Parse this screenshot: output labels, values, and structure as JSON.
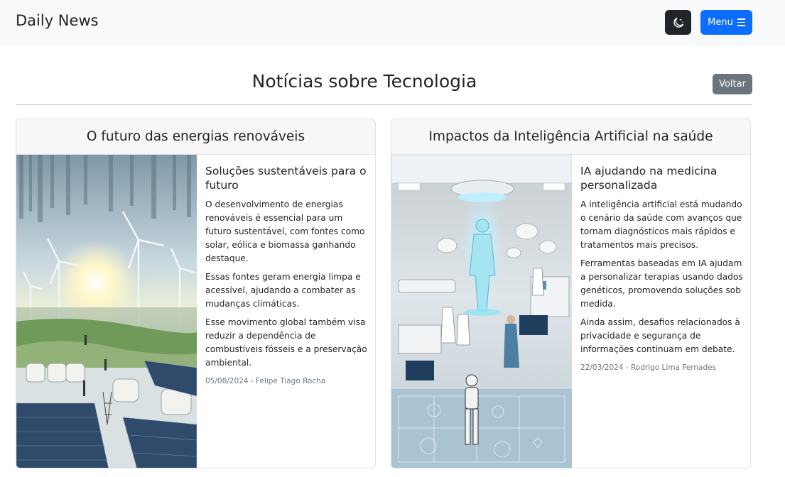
{
  "navbar": {
    "brand": "Daily News",
    "menu_label": "Menu",
    "theme_icon": "moon-stars-icon",
    "menu_icon": "hamburger-icon"
  },
  "page": {
    "title": "Notícias sobre Tecnologia",
    "back_label": "Voltar"
  },
  "colors": {
    "primary": "#0d6efd",
    "dark": "#212529",
    "secondary": "#6c757d",
    "navbar_bg": "#f8f9fa"
  },
  "articles": [
    {
      "header": "O futuro das energias renováveis",
      "title": "Soluções sustentáveis para o futuro",
      "paragraphs": [
        "O desenvolvimento de energias renováveis é essencial para um futuro sustentável, com fontes como solar, eólica e biomassa ganhando destaque.",
        "Essas fontes geram energia limpa e acessível, ajudando a combater as mudanças climáticas.",
        "Esse movimento global também visa reduzir a dependência de combustíveis fósseis e a preservação ambiental."
      ],
      "meta": "05/08/2024 - Felipe Tiago Rocha"
    },
    {
      "header": "Impactos da Inteligência Artificial na saúde",
      "title": "IA ajudando na medicina personalizada",
      "paragraphs": [
        "A inteligência artificial está mudando o cenário da saúde com avanços que tornam diagnósticos mais rápidos e tratamentos mais precisos.",
        "Ferramentas baseadas em IA ajudam a personalizar terapias usando dados genéticos, promovendo soluções sob medida.",
        "Ainda assim, desafios relacionados à privacidade e segurança de informações continuam em debate."
      ],
      "meta": "22/03/2024 - Rodrigo Lima Fernades"
    }
  ]
}
